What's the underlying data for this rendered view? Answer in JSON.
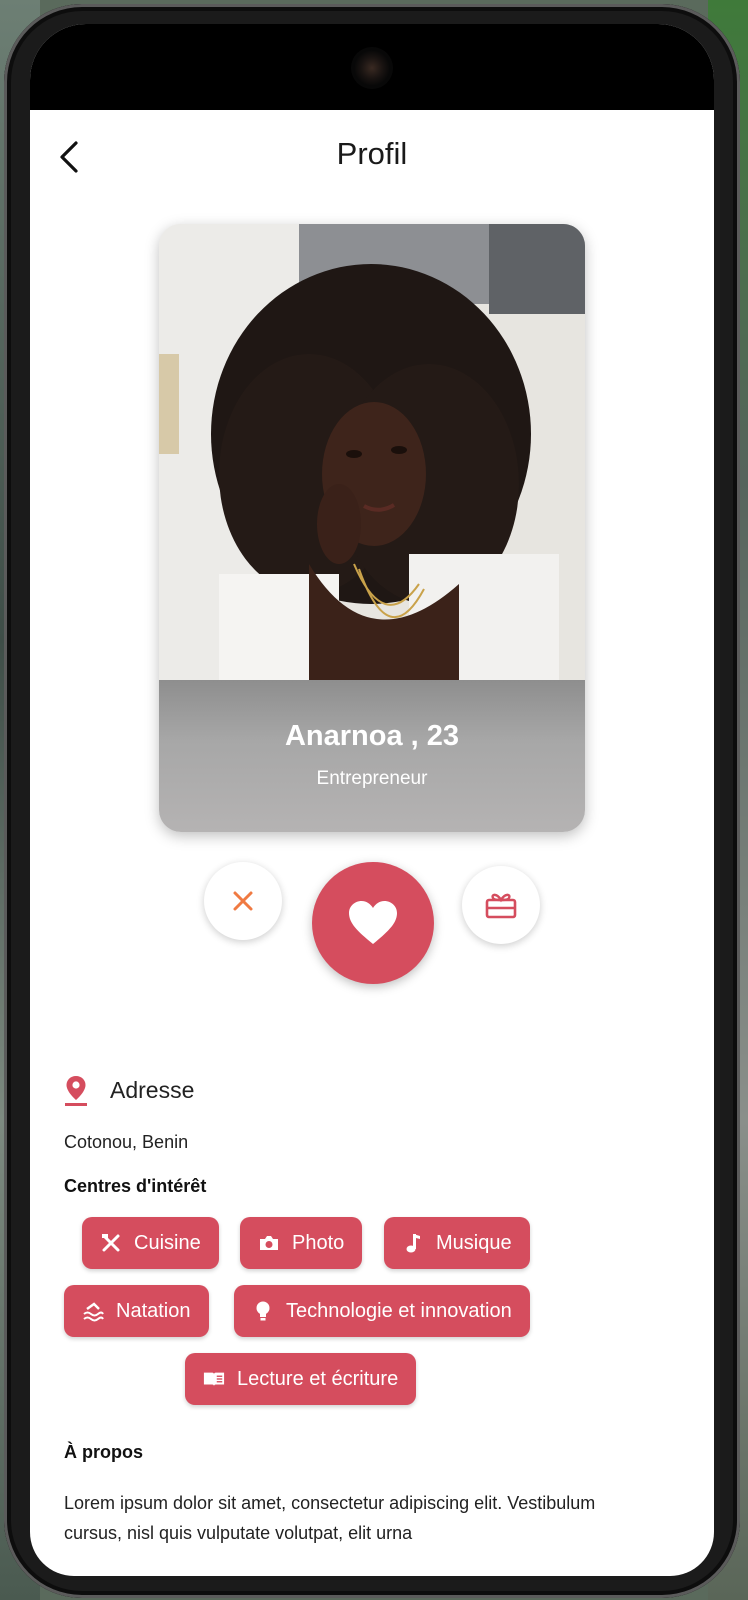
{
  "header": {
    "title": "Profil"
  },
  "profile": {
    "name_age": "Anarnoa , 23",
    "occupation": "Entrepreneur",
    "address_label": "Adresse",
    "address_value": "Cotonou, Benin",
    "interests_title": "Centres d'intérêt",
    "interests": [
      {
        "label": "Cuisine",
        "icon": "utensils-icon"
      },
      {
        "label": "Photo",
        "icon": "camera-icon"
      },
      {
        "label": "Musique",
        "icon": "music-note-icon"
      },
      {
        "label": "Natation",
        "icon": "swimming-icon"
      },
      {
        "label": "Technologie et innovation",
        "icon": "lightbulb-icon"
      },
      {
        "label": "Lecture et écriture",
        "icon": "book-icon"
      }
    ],
    "about_title": "À propos",
    "about_text": "Lorem ipsum dolor sit amet, consectetur adipiscing elit. Vestibulum cursus, nisl quis vulputate volutpat, elit urna"
  },
  "colors": {
    "accent": "#d54d5e",
    "dislike": "#f07a42"
  }
}
